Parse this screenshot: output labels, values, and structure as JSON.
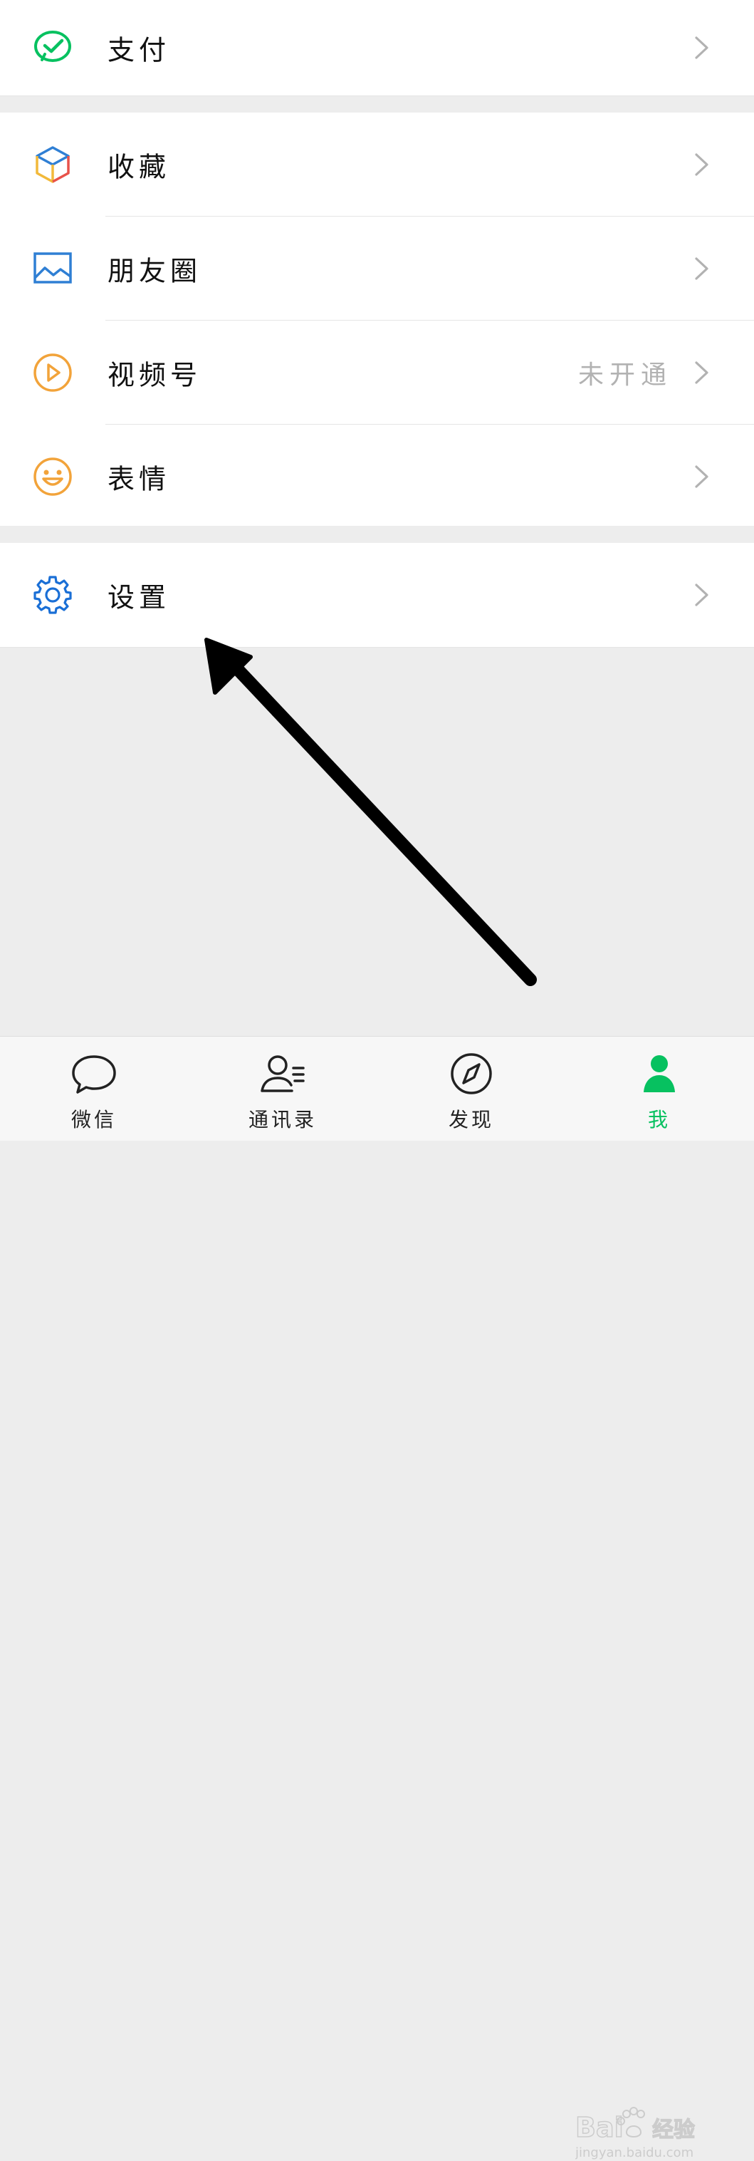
{
  "menu": {
    "pay": {
      "label": "支付",
      "icon": "wechat-pay-icon"
    },
    "favorites": {
      "label": "收藏",
      "icon": "favorites-cube-icon"
    },
    "moments": {
      "label": "朋友圈",
      "icon": "moments-image-icon"
    },
    "channels": {
      "label": "视频号",
      "value": "未开通",
      "icon": "channels-play-icon"
    },
    "stickers": {
      "label": "表情",
      "icon": "smiley-icon"
    },
    "settings": {
      "label": "设置",
      "icon": "gear-icon"
    }
  },
  "tabbar": {
    "chats": "微信",
    "contacts": "通讯录",
    "discover": "发现",
    "me": "我",
    "active": "me"
  },
  "colors": {
    "brand_green": "#07c160",
    "page_background": "#ededed",
    "card_background": "#ffffff",
    "secondary_text": "#b2b2b2",
    "settings_blue": "#1a6fd6",
    "moments_blue": "#2f7fd4",
    "channels_orange": "#f2a33a",
    "stickers_orange": "#f2a33a"
  },
  "watermark": {
    "brand": "Bai",
    "brand_suffix": "经验",
    "url": "jingyan.baidu.com"
  }
}
